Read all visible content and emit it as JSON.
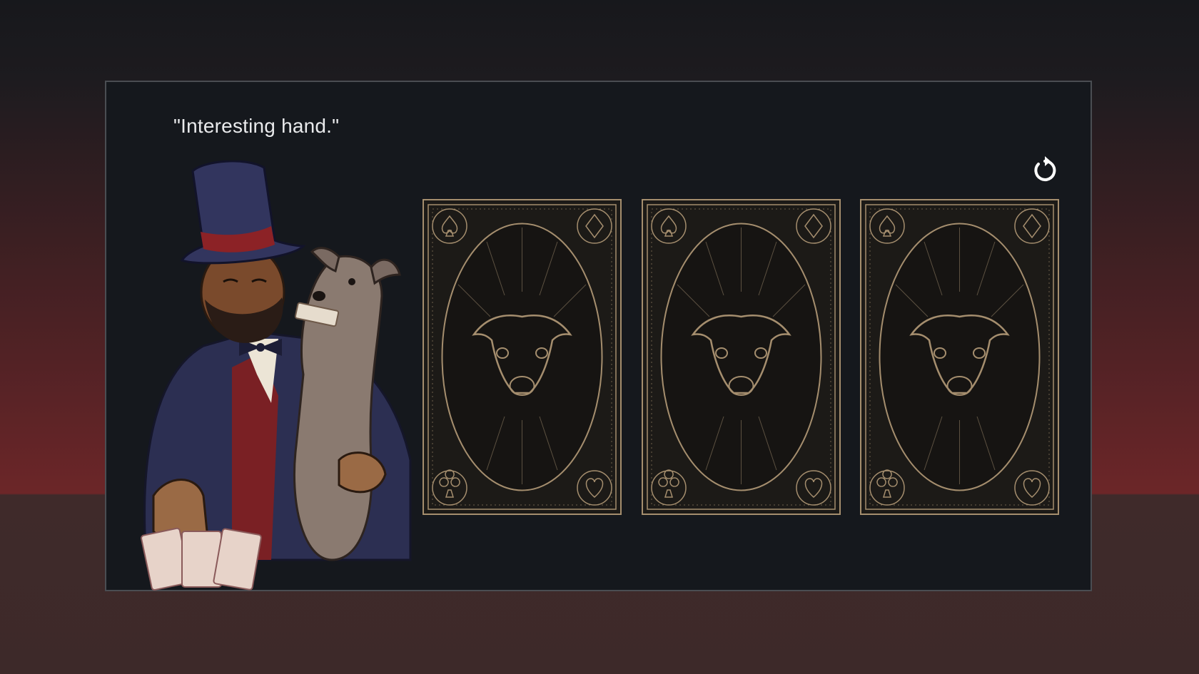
{
  "dialog": {
    "quote": "\"Interesting hand.\""
  },
  "controls": {
    "reset_icon": "rotate-ccw-icon"
  },
  "dealer": {
    "description_icon": "dealer-with-dog-illustration"
  },
  "hand": {
    "cards": [
      {
        "face": "down",
        "back_icon": "greyhound-card-back"
      },
      {
        "face": "down",
        "back_icon": "greyhound-card-back"
      },
      {
        "face": "down",
        "back_icon": "greyhound-card-back"
      }
    ]
  },
  "colors": {
    "panel": "#15181d",
    "card_gold": "#a58e6e",
    "text": "#e9eaec",
    "background_red": "#6c2628"
  }
}
